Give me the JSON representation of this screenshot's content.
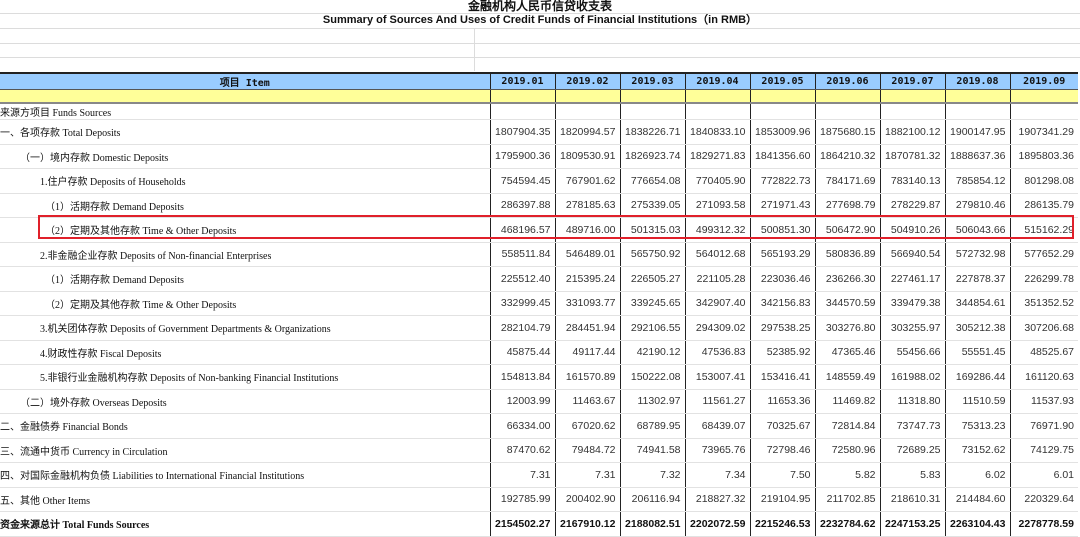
{
  "title_cn": "金融机构人民币信贷收支表",
  "title_en": "Summary of Sources And Uses of Credit Funds of Financial Institutions（in RMB）",
  "header": {
    "item": "项目 Item",
    "months": [
      "2019.01",
      "2019.02",
      "2019.03",
      "2019.04",
      "2019.05",
      "2019.06",
      "2019.07",
      "2019.08",
      "2019.09"
    ]
  },
  "highlight_color": "#e0202a",
  "rows": [
    {
      "label": "来源方项目 Funds Sources",
      "values": [
        "",
        "",
        "",
        "",
        "",
        "",
        "",
        "",
        ""
      ]
    },
    {
      "label": "一、各项存款 Total Deposits",
      "values": [
        "1807904.35",
        "1820994.57",
        "1838226.71",
        "1840833.10",
        "1853009.96",
        "1875680.15",
        "1882100.12",
        "1900147.95",
        "1907341.29"
      ]
    },
    {
      "label": "（一）境内存款 Domestic Deposits",
      "values": [
        "1795900.36",
        "1809530.91",
        "1826923.74",
        "1829271.83",
        "1841356.60",
        "1864210.32",
        "1870781.32",
        "1888637.36",
        "1895803.36"
      ]
    },
    {
      "label": "1.住户存款 Deposits of Households",
      "values": [
        "754594.45",
        "767901.62",
        "776654.08",
        "770405.90",
        "772822.73",
        "784171.69",
        "783140.13",
        "785854.12",
        "801298.08"
      ]
    },
    {
      "label": "（1）活期存款 Demand Deposits",
      "values": [
        "286397.88",
        "278185.63",
        "275339.05",
        "271093.58",
        "271971.43",
        "277698.79",
        "278229.87",
        "279810.46",
        "286135.79"
      ]
    },
    {
      "label": "（2）定期及其他存款 Time & Other Deposits",
      "values": [
        "468196.57",
        "489716.00",
        "501315.03",
        "499312.32",
        "500851.30",
        "506472.90",
        "504910.26",
        "506043.66",
        "515162.29"
      ]
    },
    {
      "label": "2.非金融企业存款 Deposits of Non-financial Enterprises",
      "values": [
        "558511.84",
        "546489.01",
        "565750.92",
        "564012.68",
        "565193.29",
        "580836.89",
        "566940.54",
        "572732.98",
        "577652.29"
      ]
    },
    {
      "label": "（1）活期存款 Demand Deposits",
      "values": [
        "225512.40",
        "215395.24",
        "226505.27",
        "221105.28",
        "223036.46",
        "236266.30",
        "227461.17",
        "227878.37",
        "226299.78"
      ]
    },
    {
      "label": "（2）定期及其他存款 Time & Other Deposits",
      "values": [
        "332999.45",
        "331093.77",
        "339245.65",
        "342907.40",
        "342156.83",
        "344570.59",
        "339479.38",
        "344854.61",
        "351352.52"
      ]
    },
    {
      "label": "3.机关团体存款 Deposits of Government Departments & Organizations",
      "values": [
        "282104.79",
        "284451.94",
        "292106.55",
        "294309.02",
        "297538.25",
        "303276.80",
        "303255.97",
        "305212.38",
        "307206.68"
      ]
    },
    {
      "label": "4.财政性存款 Fiscal Deposits",
      "values": [
        "45875.44",
        "49117.44",
        "42190.12",
        "47536.83",
        "52385.92",
        "47365.46",
        "55456.66",
        "55551.45",
        "48525.67"
      ]
    },
    {
      "label": "5.非银行业金融机构存款 Deposits of Non-banking Financial Institutions",
      "values": [
        "154813.84",
        "161570.89",
        "150222.08",
        "153007.41",
        "153416.41",
        "148559.49",
        "161988.02",
        "169286.44",
        "161120.63"
      ]
    },
    {
      "label": "（二）境外存款 Overseas Deposits",
      "values": [
        "12003.99",
        "11463.67",
        "11302.97",
        "11561.27",
        "11653.36",
        "11469.82",
        "11318.80",
        "11510.59",
        "11537.93"
      ]
    },
    {
      "label": "二、金融债券 Financial Bonds",
      "values": [
        "66334.00",
        "67020.62",
        "68789.95",
        "68439.07",
        "70325.67",
        "72814.84",
        "73747.73",
        "75313.23",
        "76971.90"
      ]
    },
    {
      "label": "三、流通中货币 Currency in Circulation",
      "values": [
        "87470.62",
        "79484.72",
        "74941.58",
        "73965.76",
        "72798.46",
        "72580.96",
        "72689.25",
        "73152.62",
        "74129.75"
      ]
    },
    {
      "label": "四、对国际金融机构负债 Liabilities to International Financial Institutions",
      "values": [
        "7.31",
        "7.31",
        "7.32",
        "7.34",
        "7.50",
        "5.82",
        "5.83",
        "6.02",
        "6.01"
      ]
    },
    {
      "label": "五、其他 Other Items",
      "values": [
        "192785.99",
        "200402.90",
        "206116.94",
        "218827.32",
        "219104.95",
        "211702.85",
        "218610.31",
        "214484.60",
        "220329.64"
      ]
    },
    {
      "label": "资金来源总计 Total Funds Sources",
      "values": [
        "2154502.27",
        "2167910.12",
        "2188082.51",
        "2202072.59",
        "2215246.53",
        "2232784.62",
        "2247153.25",
        "2263104.43",
        "2278778.59"
      ]
    }
  ]
}
